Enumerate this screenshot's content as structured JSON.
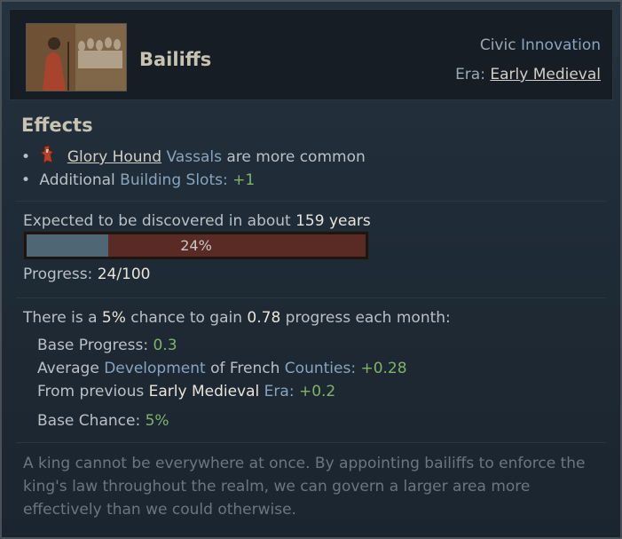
{
  "header": {
    "title": "Bailiffs",
    "category_prefix": "Civic",
    "category": "Innovation",
    "era_label": "Era:",
    "era_value": "Early Medieval"
  },
  "effects": {
    "heading": "Effects",
    "items": [
      {
        "bullet": "•",
        "icon": "glory-hound-icon",
        "link": "Glory Hound",
        "highlight": "Vassals",
        "text": "are more common"
      },
      {
        "bullet": "•",
        "prefix": "Additional",
        "highlight": "Building Slots:",
        "value": "+1"
      }
    ]
  },
  "discovery": {
    "prefix": "Expected to be discovered in about",
    "value": "159 years",
    "progress_fraction": 0.24,
    "progress_label": "24%",
    "progress_text_label": "Progress:",
    "progress_text_value": "24/100"
  },
  "chance": {
    "prefix": "There is a",
    "chance_value": "5%",
    "mid": "chance to gain",
    "progress_value": "0.78",
    "suffix": "progress each month:",
    "base_progress_label": "Base Progress:",
    "base_progress_value": "0.3",
    "avg_prefix": "Average",
    "avg_highlight": "Development",
    "avg_mid": "of French",
    "avg_highlight2": "Counties:",
    "avg_value": "+0.28",
    "prev_prefix": "From previous",
    "prev_white": "Early Medieval",
    "prev_highlight": "Era:",
    "prev_value": "+0.2",
    "base_chance_label": "Base Chance:",
    "base_chance_value": "5%"
  },
  "flavor": {
    "line1": "A king cannot be everywhere at once. By appointing bailiffs to enforce the",
    "line2": "king's law throughout the realm, we can govern a larger area more",
    "line3": "effectively than we could otherwise."
  },
  "colors": {
    "accent_blue": "#87a5bf",
    "positive_green": "#7fb36b",
    "bar_fill": "#4f6674",
    "bar_track": "#5a2a24"
  }
}
